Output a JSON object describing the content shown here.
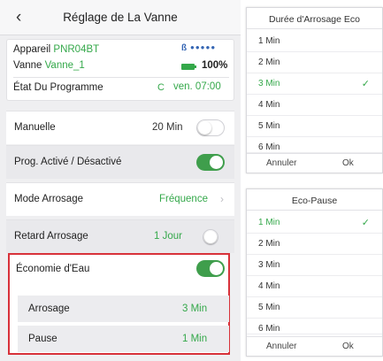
{
  "screen": {
    "back_icon": "chevron-left-icon",
    "title": "Réglage de La Vanne"
  },
  "device": {
    "appareil_label": "Appareil",
    "appareil_value": "PNR04BT",
    "vanne_label": "Vanne",
    "vanne_value": "Vanne_1",
    "battery_pct": "100%",
    "etat_label": "État Du Programme",
    "etat_value": "ven. 07:00"
  },
  "settings": {
    "manuelle_label": "Manuelle",
    "manuelle_value": "20 Min",
    "prog_label": "Prog. Activé / Désactivé",
    "mode_label": "Mode Arrosage",
    "mode_value": "Fréquence",
    "retard_label": "Retard Arrosage",
    "retard_value": "1 Jour",
    "eco_label": "Économie d'Eau",
    "arrosage_label": "Arrosage",
    "arrosage_value": "3 Min",
    "pause_label": "Pause",
    "pause_value": "1 Min"
  },
  "dialog_duree": {
    "title": "Durée d'Arrosage Eco",
    "options": [
      "1 Min",
      "2 Min",
      "3 Min",
      "4 Min",
      "5 Min",
      "6 Min"
    ],
    "selected": "3 Min",
    "cancel": "Annuler",
    "ok": "Ok"
  },
  "dialog_pause": {
    "title": "Eco-Pause",
    "options": [
      "1 Min",
      "2 Min",
      "3 Min",
      "4 Min",
      "5 Min",
      "6 Min"
    ],
    "selected": "1 Min",
    "cancel": "Annuler",
    "ok": "Ok"
  },
  "colors": {
    "accent_green": "#34a84a",
    "highlight_red": "#d8323a",
    "bluetooth_blue": "#3465b3"
  }
}
